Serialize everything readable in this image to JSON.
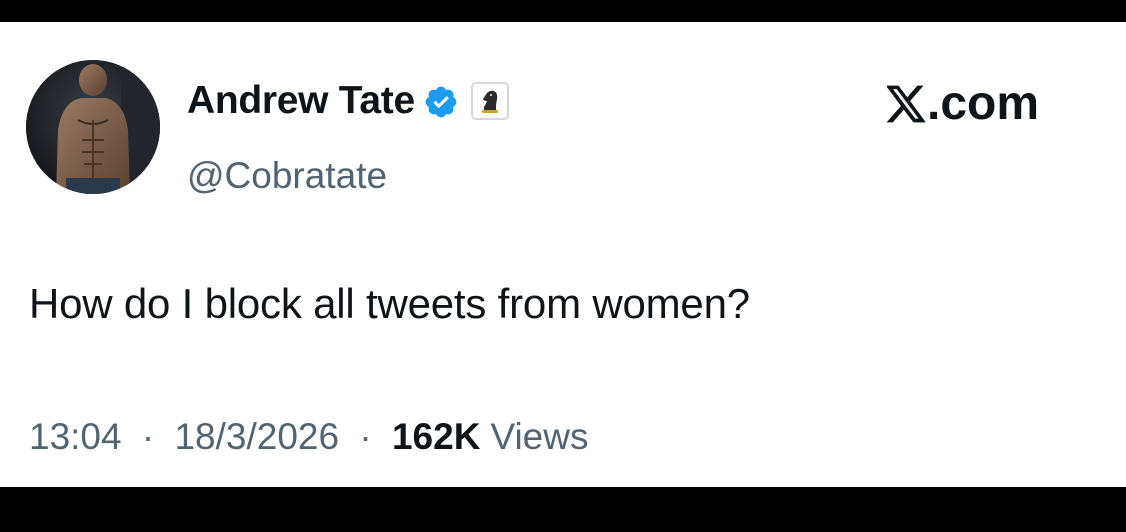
{
  "author": {
    "display_name": "Andrew Tate",
    "handle": "@Cobratate",
    "verified_icon": "verified-badge-icon",
    "affiliate_icon": "chess-knight-icon"
  },
  "brand": {
    "text": ".com",
    "logo_icon": "x-logo-icon"
  },
  "tweet": {
    "text": "How do I block all tweets from women?"
  },
  "meta": {
    "time": "13:04",
    "separator": "·",
    "date": "18/3/2026",
    "views_count": "162K",
    "views_label": "Views"
  },
  "colors": {
    "text_primary": "#0f1419",
    "text_secondary": "#536471",
    "verified_blue": "#1d9bf0",
    "background": "#ffffff",
    "letterbox": "#000000"
  }
}
